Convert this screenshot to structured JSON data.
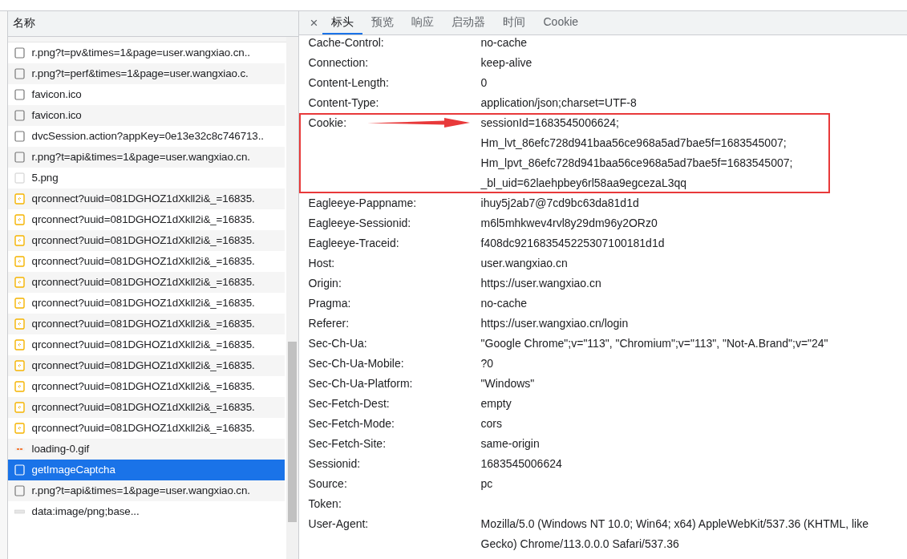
{
  "requests": {
    "column_title": "名称",
    "items": [
      {
        "name": "r.png?t=pv&times=1&page=user.wangxiao.cn..",
        "kind": "document",
        "selected": false
      },
      {
        "name": "r.png?t=perf&times=1&page=user.wangxiao.c.",
        "kind": "document",
        "selected": false
      },
      {
        "name": "favicon.ico",
        "kind": "document",
        "selected": false
      },
      {
        "name": "favicon.ico",
        "kind": "document",
        "selected": false
      },
      {
        "name": "dvcSession.action?appKey=0e13e32c8c746713..",
        "kind": "document",
        "selected": false
      },
      {
        "name": "r.png?t=api&times=1&page=user.wangxiao.cn.",
        "kind": "document",
        "selected": false
      },
      {
        "name": "5.png",
        "kind": "image",
        "selected": false
      },
      {
        "name": "qrconnect?uuid=081DGHOZ1dXkll2i&_=16835.",
        "kind": "script",
        "selected": false
      },
      {
        "name": "qrconnect?uuid=081DGHOZ1dXkll2i&_=16835.",
        "kind": "script",
        "selected": false
      },
      {
        "name": "qrconnect?uuid=081DGHOZ1dXkll2i&_=16835.",
        "kind": "script",
        "selected": false
      },
      {
        "name": "qrconnect?uuid=081DGHOZ1dXkll2i&_=16835.",
        "kind": "script",
        "selected": false
      },
      {
        "name": "qrconnect?uuid=081DGHOZ1dXkll2i&_=16835.",
        "kind": "script",
        "selected": false
      },
      {
        "name": "qrconnect?uuid=081DGHOZ1dXkll2i&_=16835.",
        "kind": "script",
        "selected": false
      },
      {
        "name": "qrconnect?uuid=081DGHOZ1dXkll2i&_=16835.",
        "kind": "script",
        "selected": false
      },
      {
        "name": "qrconnect?uuid=081DGHOZ1dXkll2i&_=16835.",
        "kind": "script",
        "selected": false
      },
      {
        "name": "qrconnect?uuid=081DGHOZ1dXkll2i&_=16835.",
        "kind": "script",
        "selected": false
      },
      {
        "name": "qrconnect?uuid=081DGHOZ1dXkll2i&_=16835.",
        "kind": "script",
        "selected": false
      },
      {
        "name": "qrconnect?uuid=081DGHOZ1dXkll2i&_=16835.",
        "kind": "script",
        "selected": false
      },
      {
        "name": "qrconnect?uuid=081DGHOZ1dXkll2i&_=16835.",
        "kind": "script",
        "selected": false
      },
      {
        "name": "loading-0.gif",
        "kind": "gif",
        "selected": false
      },
      {
        "name": "getImageCaptcha",
        "kind": "document",
        "selected": true
      },
      {
        "name": "r.png?t=api&times=1&page=user.wangxiao.cn.",
        "kind": "document",
        "selected": false
      },
      {
        "name": "data:image/png;base...",
        "kind": "data",
        "selected": false
      }
    ]
  },
  "details": {
    "close": "×",
    "tabs": [
      {
        "label": "标头",
        "selected": true
      },
      {
        "label": "预览",
        "selected": false
      },
      {
        "label": "响应",
        "selected": false
      },
      {
        "label": "启动器",
        "selected": false
      },
      {
        "label": "时间",
        "selected": false
      },
      {
        "label": "Cookie",
        "selected": false
      }
    ],
    "headers": [
      {
        "name": "Cache-Control:",
        "values": [
          "no-cache"
        ],
        "highlighted": false
      },
      {
        "name": "Connection:",
        "values": [
          "keep-alive"
        ],
        "highlighted": false
      },
      {
        "name": "Content-Length:",
        "values": [
          "0"
        ],
        "highlighted": false
      },
      {
        "name": "Content-Type:",
        "values": [
          "application/json;charset=UTF-8"
        ],
        "highlighted": false
      },
      {
        "name": "Cookie:",
        "values": [
          "sessionId=1683545006624;",
          "Hm_lvt_86efc728d941baa56ce968a5ad7bae5f=1683545007;",
          "Hm_lpvt_86efc728d941baa56ce968a5ad7bae5f=1683545007;",
          "_bl_uid=62laehpbey6rl58aa9egcezaL3qq"
        ],
        "highlighted": true
      },
      {
        "name": "Eagleeye-Pappname:",
        "values": [
          "ihuy5j2ab7@7cd9bc63da81d1d"
        ],
        "highlighted": false
      },
      {
        "name": "Eagleeye-Sessionid:",
        "values": [
          "m6l5mhkwev4rvl8y29dm96y2ORz0"
        ],
        "highlighted": false
      },
      {
        "name": "Eagleeye-Traceid:",
        "values": [
          "f408dc921683545225307100181d1d"
        ],
        "highlighted": false
      },
      {
        "name": "Host:",
        "values": [
          "user.wangxiao.cn"
        ],
        "highlighted": false
      },
      {
        "name": "Origin:",
        "values": [
          "https://user.wangxiao.cn"
        ],
        "highlighted": false
      },
      {
        "name": "Pragma:",
        "values": [
          "no-cache"
        ],
        "highlighted": false
      },
      {
        "name": "Referer:",
        "values": [
          "https://user.wangxiao.cn/login"
        ],
        "highlighted": false
      },
      {
        "name": "Sec-Ch-Ua:",
        "values": [
          "\"Google Chrome\";v=\"113\", \"Chromium\";v=\"113\", \"Not-A.Brand\";v=\"24\""
        ],
        "highlighted": false
      },
      {
        "name": "Sec-Ch-Ua-Mobile:",
        "values": [
          "?0"
        ],
        "highlighted": false
      },
      {
        "name": "Sec-Ch-Ua-Platform:",
        "values": [
          "\"Windows\""
        ],
        "highlighted": false
      },
      {
        "name": "Sec-Fetch-Dest:",
        "values": [
          "empty"
        ],
        "highlighted": false
      },
      {
        "name": "Sec-Fetch-Mode:",
        "values": [
          "cors"
        ],
        "highlighted": false
      },
      {
        "name": "Sec-Fetch-Site:",
        "values": [
          "same-origin"
        ],
        "highlighted": false
      },
      {
        "name": "Sessionid:",
        "values": [
          "1683545006624"
        ],
        "highlighted": false
      },
      {
        "name": "Source:",
        "values": [
          "pc"
        ],
        "highlighted": false
      },
      {
        "name": "Token:",
        "highlighted": false
      },
      {
        "name": "User-Agent:",
        "values": [
          "Mozilla/5.0 (Windows NT 10.0; Win64; x64) AppleWebKit/537.36 (KHTML, like Gecko) Chrome/113.0.0.0 Safari/537.36"
        ],
        "highlighted": false
      }
    ]
  }
}
